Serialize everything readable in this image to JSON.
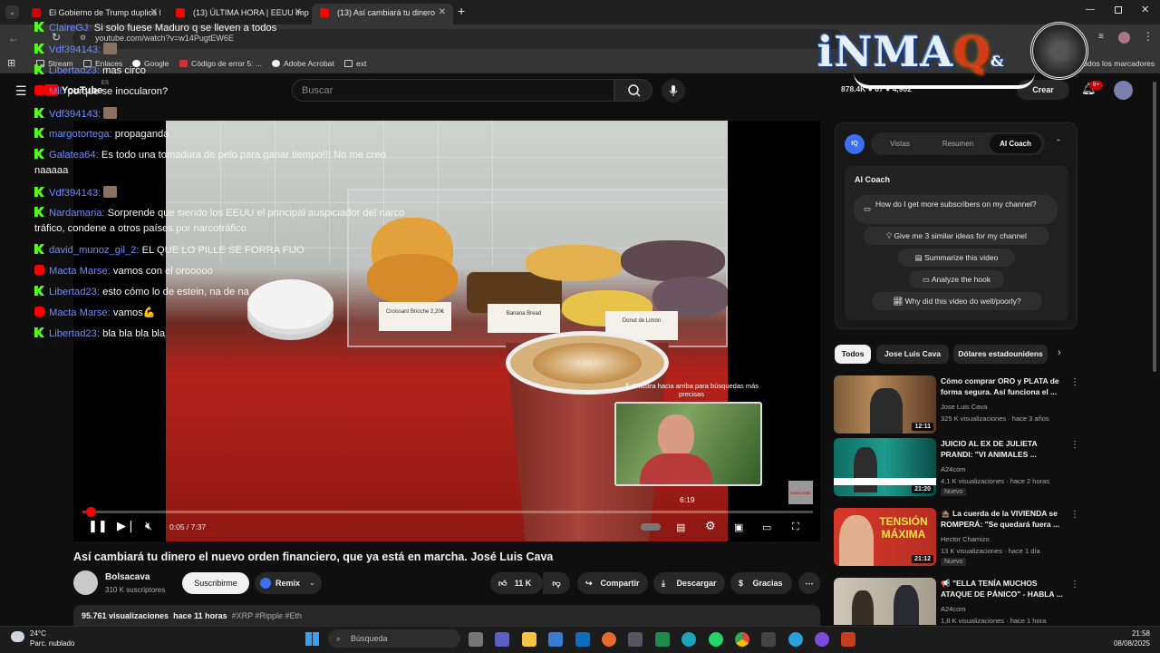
{
  "browser": {
    "tabs": [
      {
        "label": "El Gobierno de Trump duplica l",
        "favicon_color": "#cc0000",
        "active": false
      },
      {
        "label": "(13) ÚLTIMA HORA | EEUU impo",
        "favicon_color": "#ff0000",
        "active": false
      },
      {
        "label": "(13) Así cambiará tu dinero",
        "favicon_color": "#ff0000",
        "active": true
      }
    ],
    "url": "youtube.com/watch?v=w14PugtEW6E",
    "bookmarks": [
      "Stream",
      "Enlaces",
      "Google",
      "Código de error 5: ...",
      "Adobe Acrobat",
      "ext"
    ],
    "bookmarks_right": "Todos los marcadores"
  },
  "youtube": {
    "logo": "YouTube",
    "country_code": "ES",
    "search_placeholder": "Buscar",
    "stats": "878.4K  ● 67  ● 4,902",
    "create_label": "Crear",
    "notif_count": "9+"
  },
  "chat": [
    {
      "platform": "kick",
      "user": "ClaireGJ",
      "text": "Si solo fuese Maduro q se lleven a todos"
    },
    {
      "platform": "kick",
      "user": "Vdf394143",
      "text": "",
      "emote": true
    },
    {
      "platform": "kick",
      "user": "Libertad23",
      "text": "mas circo"
    },
    {
      "platform": "youtube",
      "user": "Mil",
      "text": "porque se inocularon?"
    },
    {
      "platform": "kick",
      "user": "Vdf394143",
      "text": "",
      "emote": true
    },
    {
      "platform": "kick",
      "user": "margotortega",
      "text": "propaganda"
    },
    {
      "platform": "kick",
      "user": "Galatea64",
      "text": "Es todo una tomadura de pelo para ganar tiempo!!! No me creo",
      "continuation": "naaaaa"
    },
    {
      "platform": "kick",
      "user": "Vdf394143",
      "text": "",
      "emote": true
    },
    {
      "platform": "kick",
      "user": "Nardamaria",
      "text": "Sorprende que siendo los EEUU el principal auspiciador del narco",
      "continuation": "tráfico, condene a otros países por narcotráfico"
    },
    {
      "platform": "kick",
      "user": "david_munoz_gil_2",
      "text": "EL QUE LO PILLE SE FORRA FIJO"
    },
    {
      "platform": "youtube",
      "user": "Macta Marse",
      "text": "vamos con el orooooo"
    },
    {
      "platform": "kick",
      "user": "Libertad23",
      "text": "esto cómo lo de estein, na de na"
    },
    {
      "platform": "youtube",
      "user": "Macta Marse",
      "text": "vamos💪"
    },
    {
      "platform": "kick",
      "user": "Libertad23",
      "text": "bla bla bla bla"
    }
  ],
  "video": {
    "signs": [
      "Croissant Brioche 2,20€",
      "Banana Bread",
      "Donut de Limón"
    ],
    "pip_hint": "Arrastra hacia arriba para búsquedas más precisas",
    "pip_time": "6:19",
    "current_time": "0:05",
    "duration": "7:37",
    "progress": 0.011,
    "subscribe_watermark": "SUBSCRIBE"
  },
  "meta": {
    "title": "Así cambiará tu dinero el nuevo orden financiero, que ya está en marcha. José Luis Cava",
    "channel": "Bolsacava",
    "subscribers": "310 K suscriptores",
    "subscribe_label": "Suscribirme",
    "remix_label": "Remix",
    "likes": "11 K",
    "share_label": "Compartir",
    "download_label": "Descargar",
    "thanks_label": "Gracias",
    "views": "95.761 visualizaciones",
    "age": "hace 11 horas",
    "tags": "#XRP #Ripple #Eth"
  },
  "coach": {
    "badge": "IQ",
    "tabs": [
      "Vistas",
      "Resumen",
      "AI Coach"
    ],
    "active_tab": "AI Coach",
    "heading": "AI Coach",
    "suggestions": [
      "How do I get more subscribers on my channel?",
      "Give me 3 similar ideas for my channel",
      "Summarize this video",
      "Analyze the hook",
      "Why did this video do well/poorly?"
    ]
  },
  "chips": [
    "Todos",
    "Jose Luis Cava",
    "Dólares estadounidens"
  ],
  "recommendations": [
    {
      "title": "Cómo comprar ORO y PLATA de forma segura. Así funciona el ...",
      "channel": "Jose Luis Cava",
      "meta": "325 K visualizaciones · hace 3 años",
      "duration": "12:11",
      "new": ""
    },
    {
      "title": "JUICIO AL EX DE JULIETA PRANDI: \"VI ANIMALES ...",
      "channel": "A24com",
      "meta": "4,1 K visualizaciones · hace 2 horas",
      "duration": "21:20",
      "new": "Nuevo"
    },
    {
      "title": "🏚️ La cuerda de la VIVIENDA se ROMPERÁ: \"Se quedará fuera ...",
      "channel": "Hector Chamizo",
      "meta": "13 K visualizaciones · hace 1 día",
      "duration": "21:12",
      "new": "Nuevo",
      "thumb_text": "TENSIÓN MÁXIMA"
    },
    {
      "title": "📢 \"ELLA TENÍA MUCHOS ATAQUE DE PÁNICO\" - HABLA ...",
      "channel": "A24com",
      "meta": "1,8 K visualizaciones · hace 1 hora",
      "duration": "",
      "new": ""
    }
  ],
  "logo": {
    "text": "iNMA",
    "q": "Q",
    "amp": "&"
  },
  "taskbar": {
    "temp": "24°C",
    "weather": "Parc. nublado",
    "search_placeholder": "Búsqueda",
    "time": "21:58",
    "date": "08/08/2025"
  }
}
